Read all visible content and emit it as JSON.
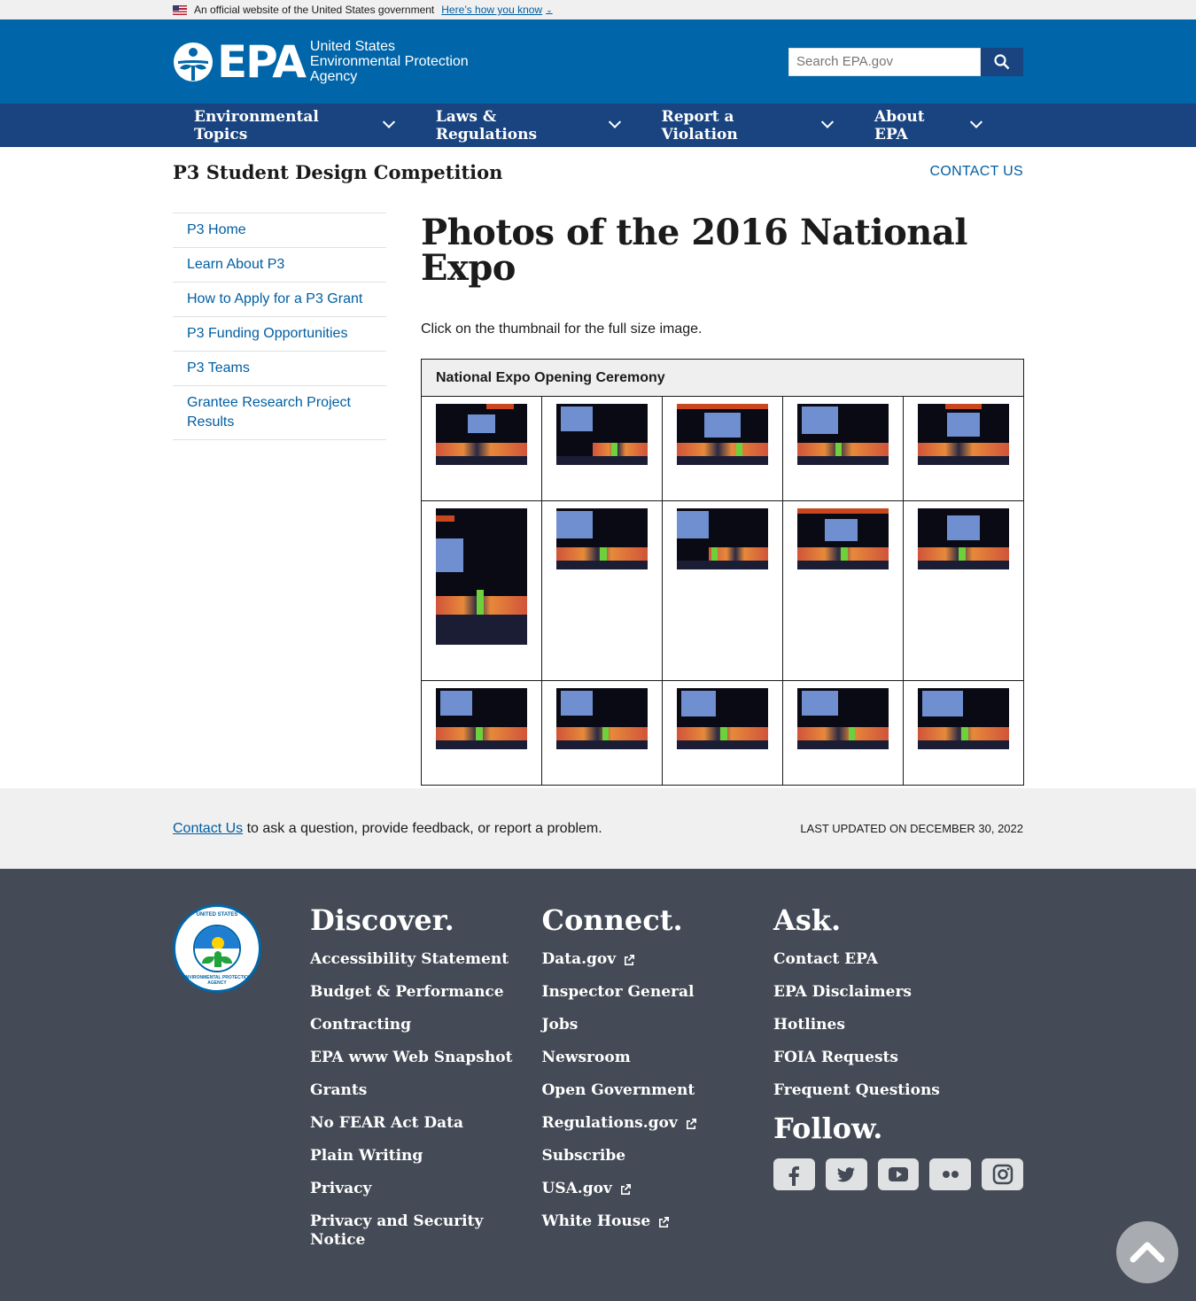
{
  "gov_banner": {
    "text": "An official website of the United States government",
    "link": "Here’s how you know"
  },
  "header": {
    "logo_word": "EPA",
    "agency_line1": "United States",
    "agency_line2": "Environmental Protection",
    "agency_line3": "Agency",
    "search_placeholder": "Search EPA.gov"
  },
  "nav": {
    "items": [
      {
        "label": "Environmental Topics"
      },
      {
        "label": "Laws & Regulations"
      },
      {
        "label": "Report a Violation"
      },
      {
        "label": "About EPA"
      }
    ]
  },
  "microsite": {
    "title": "P3 Student Design Competition",
    "contact": "CONTACT US"
  },
  "sidenav": {
    "items": [
      {
        "label": "P3 Home"
      },
      {
        "label": "Learn About P3"
      },
      {
        "label": "How to Apply for a P3 Grant"
      },
      {
        "label": "P3 Funding Opportunities"
      },
      {
        "label": "P3 Teams"
      },
      {
        "label": "Grantee Research Project Results"
      }
    ]
  },
  "main": {
    "title": "Photos of the 2016 National Expo",
    "intro": "Click on the thumbnail for the full size image.",
    "table_header": "National Expo Opening Ceremony"
  },
  "updated_bar": {
    "contact_link": "Contact Us",
    "contact_rest": " to ask a question, provide feedback, or report a problem.",
    "last_updated": "LAST UPDATED ON DECEMBER 30, 2022"
  },
  "footer": {
    "seal_top": "UNITED STATES",
    "seal_bottom": "ENVIRONMENTAL PROTECTION AGENCY",
    "discover": {
      "heading": "Discover.",
      "links": [
        "Accessibility Statement",
        "Budget & Performance",
        "Contracting",
        "EPA www Web Snapshot",
        "Grants",
        "No FEAR Act Data",
        "Plain Writing",
        "Privacy",
        "Privacy and Security Notice"
      ]
    },
    "connect": {
      "heading": "Connect.",
      "links": [
        "Data.gov",
        "Inspector General",
        "Jobs",
        "Newsroom",
        "Open Government",
        "Regulations.gov",
        "Subscribe",
        "USA.gov",
        "White House"
      ]
    },
    "ask": {
      "heading": "Ask.",
      "links": [
        "Contact EPA",
        "EPA Disclaimers",
        "Hotlines",
        "FOIA Requests",
        "Frequent Questions"
      ]
    },
    "follow": {
      "heading": "Follow.",
      "icons": [
        "facebook-icon",
        "twitter-icon",
        "youtube-icon",
        "flickr-icon",
        "instagram-icon"
      ]
    }
  },
  "colors": {
    "header_blue": "#0065a9",
    "nav_blue": "#1a4480",
    "link_blue": "#005ea2",
    "footer_gray": "#444b56"
  }
}
